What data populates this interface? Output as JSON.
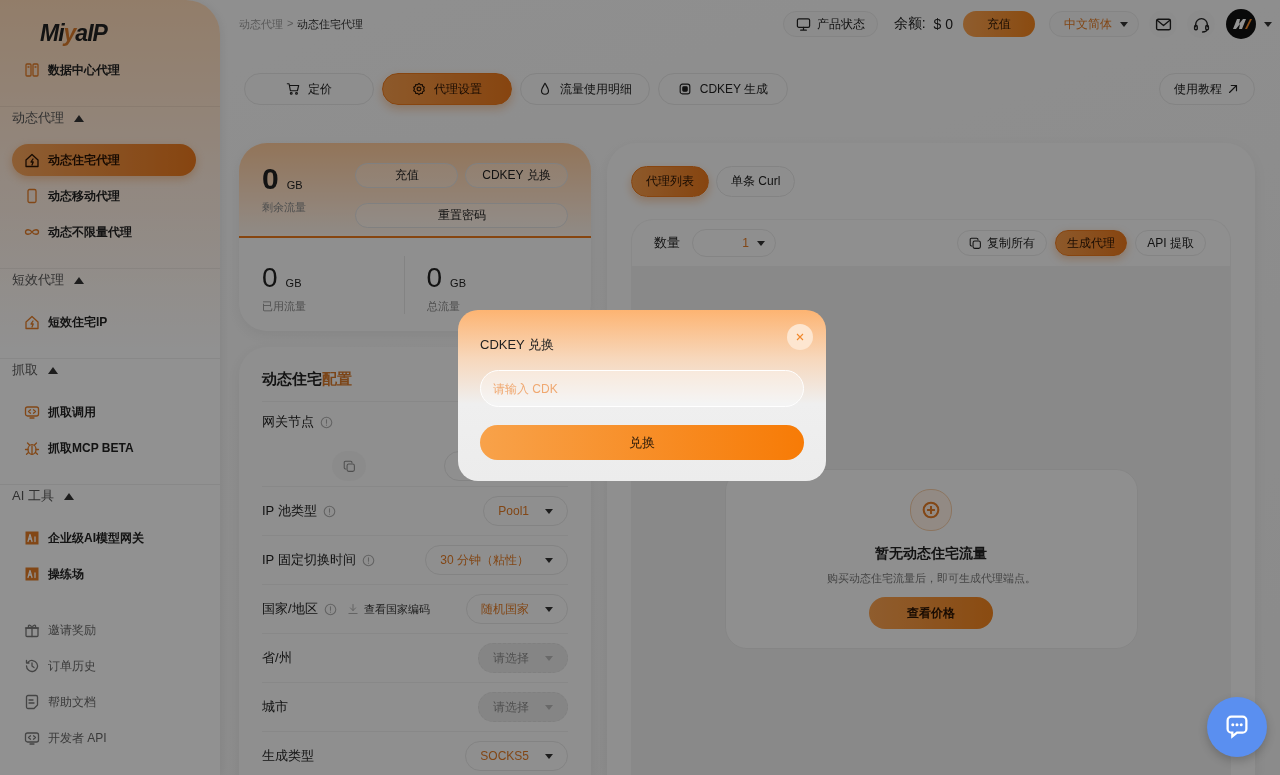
{
  "sidebar": {
    "logo": [
      "Mi",
      "y",
      "aIP"
    ],
    "top_items": [
      {
        "label": "数据中心代理",
        "selected": false
      }
    ],
    "sections": [
      {
        "title": "动态代理",
        "expanded": true,
        "items": [
          {
            "label": "动态住宅代理",
            "selected": true
          },
          {
            "label": "动态移动代理",
            "selected": false
          },
          {
            "label": "动态不限量代理",
            "selected": false
          }
        ]
      },
      {
        "title": "短效代理",
        "expanded": true,
        "items": [
          {
            "label": "短效住宅IP",
            "selected": false
          }
        ]
      },
      {
        "title": "抓取",
        "expanded": true,
        "items": [
          {
            "label": "抓取调用",
            "selected": false
          },
          {
            "label": "抓取MCP BETA",
            "selected": false
          }
        ]
      },
      {
        "title": "AI 工具",
        "expanded": true,
        "items": [
          {
            "label": "企业级AI模型网关",
            "selected": false
          },
          {
            "label": "操练场",
            "selected": false
          }
        ]
      }
    ],
    "links": [
      {
        "label": "邀请奖励",
        "selected": false
      },
      {
        "label": "订单历史",
        "selected": false
      },
      {
        "label": "帮助文档",
        "selected": false
      },
      {
        "label": "开发者 API",
        "selected": false
      }
    ]
  },
  "breadcrumb": {
    "items": [
      "动态代理",
      "动态住宅代理"
    ],
    "separator": ">"
  },
  "header": {
    "status_button": "产品状态",
    "balance_label": "余额:",
    "balance_value": "$ 0",
    "recharge_button": "充值",
    "language": "中文简体"
  },
  "tabs": [
    {
      "label": "定价",
      "selected": false
    },
    {
      "label": "代理设置",
      "selected": true
    },
    {
      "label": "流量使用明细",
      "selected": false
    },
    {
      "label": "CDKEY 生成",
      "selected": false
    }
  ],
  "tutorial_button": "使用教程",
  "traffic": {
    "remaining": {
      "value": "0",
      "unit": "GB",
      "label": "剩余流量"
    },
    "buttons": [
      "充值",
      "CDKEY 兑换",
      "重置密码"
    ],
    "stats": [
      {
        "value": "0",
        "unit": "GB",
        "label": "已用流量"
      },
      {
        "value": "0",
        "unit": "GB",
        "label": "总流量"
      }
    ]
  },
  "config": {
    "title": "动态住宅",
    "title_accent": "配置",
    "gateway": {
      "label": "网关节点",
      "info": true
    },
    "rows": [
      {
        "label": "IP 池类型",
        "info": true,
        "value": "Pool1",
        "disabled": false
      },
      {
        "label": "IP 固定切换时间",
        "info": true,
        "value": "30 分钟（粘性）",
        "disabled": false
      },
      {
        "label": "国家/地区",
        "info": true,
        "link": "查看国家编码",
        "value": "随机国家",
        "disabled": false
      },
      {
        "label": "省/州",
        "info": false,
        "placeholder": "请选择",
        "disabled": true
      },
      {
        "label": "城市",
        "info": false,
        "placeholder": "请选择",
        "disabled": true
      },
      {
        "label": "生成类型",
        "info": false,
        "value": "SOCKS5",
        "disabled": false
      }
    ]
  },
  "proxy_panel": {
    "tabs": [
      {
        "label": "代理列表",
        "selected": true
      },
      {
        "label": "单条 Curl",
        "selected": false
      }
    ],
    "quantity_label": "数量",
    "quantity_value": "1",
    "actions": [
      {
        "label": "复制所有",
        "selected": false
      },
      {
        "label": "生成代理",
        "selected": true
      },
      {
        "label": "API 提取",
        "selected": false
      }
    ],
    "empty": {
      "title": "暂无动态住宅流量",
      "text": "购买动态住宅流量后，即可生成代理端点。",
      "button": "查看价格"
    }
  },
  "modal": {
    "title": "CDKEY 兑换",
    "placeholder": "请输入 CDK",
    "button": "兑换"
  }
}
